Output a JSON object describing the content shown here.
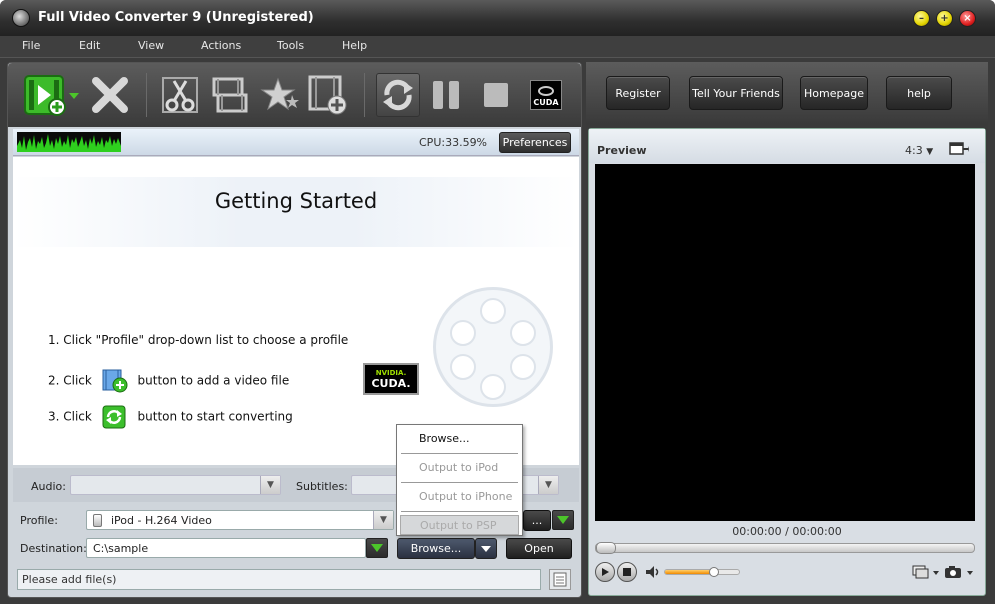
{
  "window": {
    "title": "Full Video Converter 9 (Unregistered)"
  },
  "menu": [
    {
      "label": "File"
    },
    {
      "label": "Edit"
    },
    {
      "label": "View"
    },
    {
      "label": "Actions"
    },
    {
      "label": "Tools"
    },
    {
      "label": "Help"
    }
  ],
  "toolbar": {
    "icons": [
      "add-video-icon",
      "delete-icon",
      "cut-icon",
      "merge-icon",
      "effect-star-icon",
      "add-segment-icon",
      "convert-icon",
      "pause-icon",
      "stop-icon",
      "cuda-icon"
    ],
    "cuda_label": "CUDA"
  },
  "status_strip": {
    "cpu": "CPU:33.59%",
    "preferences_label": "Preferences"
  },
  "getting_started": {
    "title": "Getting Started",
    "step1": "1. Click \"Profile\" drop-down list to choose a profile",
    "step2_pre": "2. Click",
    "step2_post": "button to add a video file",
    "step3_pre": "3. Click",
    "step3_post": "button to start converting",
    "cuda_badge_top": "NVIDIA.",
    "cuda_badge_bottom": "CUDA."
  },
  "options": {
    "audio_label": "Audio:",
    "subtitles_label": "Subtitles:",
    "profile_label": "Profile:",
    "profile_value": "iPod - H.264 Video",
    "profile_settings_label": "...",
    "destination_label": "Destination:",
    "destination_value": "C:\\sample",
    "browse_label": "Browse...",
    "open_label": "Open"
  },
  "popup": {
    "items": [
      {
        "label": "Browse...",
        "enabled": true
      },
      {
        "label": "Output to iPod",
        "enabled": false
      },
      {
        "label": "Output to iPhone",
        "enabled": false
      },
      {
        "label": "Output to PSP",
        "enabled": false
      }
    ]
  },
  "statusbar": {
    "message": "Please add file(s)"
  },
  "right_buttons": {
    "register": "Register",
    "tell_friends": "Tell Your Friends",
    "homepage": "Homepage",
    "help": "help"
  },
  "preview": {
    "title": "Preview",
    "ratio": "4:3",
    "time": "00:00:00 / 00:00:00",
    "seek_progress": 0,
    "volume": 0.66
  },
  "colors": {
    "accent_green": "#4cc52a",
    "volume": "#f08a00",
    "screen": "#000000"
  }
}
